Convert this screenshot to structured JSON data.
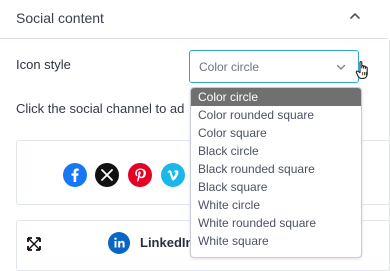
{
  "panel": {
    "title": "Social content"
  },
  "icon_style": {
    "label": "Icon style",
    "selected_value": "Color circle",
    "options": [
      "Color circle",
      "Color rounded square",
      "Color square",
      "Black circle",
      "Black rounded square",
      "Black square",
      "White circle",
      "White rounded square",
      "White square"
    ]
  },
  "instruction": {
    "text": "Click the social channel to ad"
  },
  "social_preview": {
    "channels": [
      "facebook",
      "x",
      "pinterest",
      "vimeo"
    ]
  },
  "channel_item": {
    "label": "LinkedIn"
  },
  "colors": {
    "accent": "#2ea7d8",
    "selected_option": "#707070",
    "facebook": "#1877f2",
    "x": "#111111",
    "pinterest": "#e60023",
    "vimeo": "#1ab7ea",
    "linkedin": "#0a66c2"
  },
  "icons": {
    "collapse": "chevron-up-icon",
    "select": "chevron-down-icon",
    "cursor": "hand-cursor-icon",
    "move": "move-icon"
  }
}
